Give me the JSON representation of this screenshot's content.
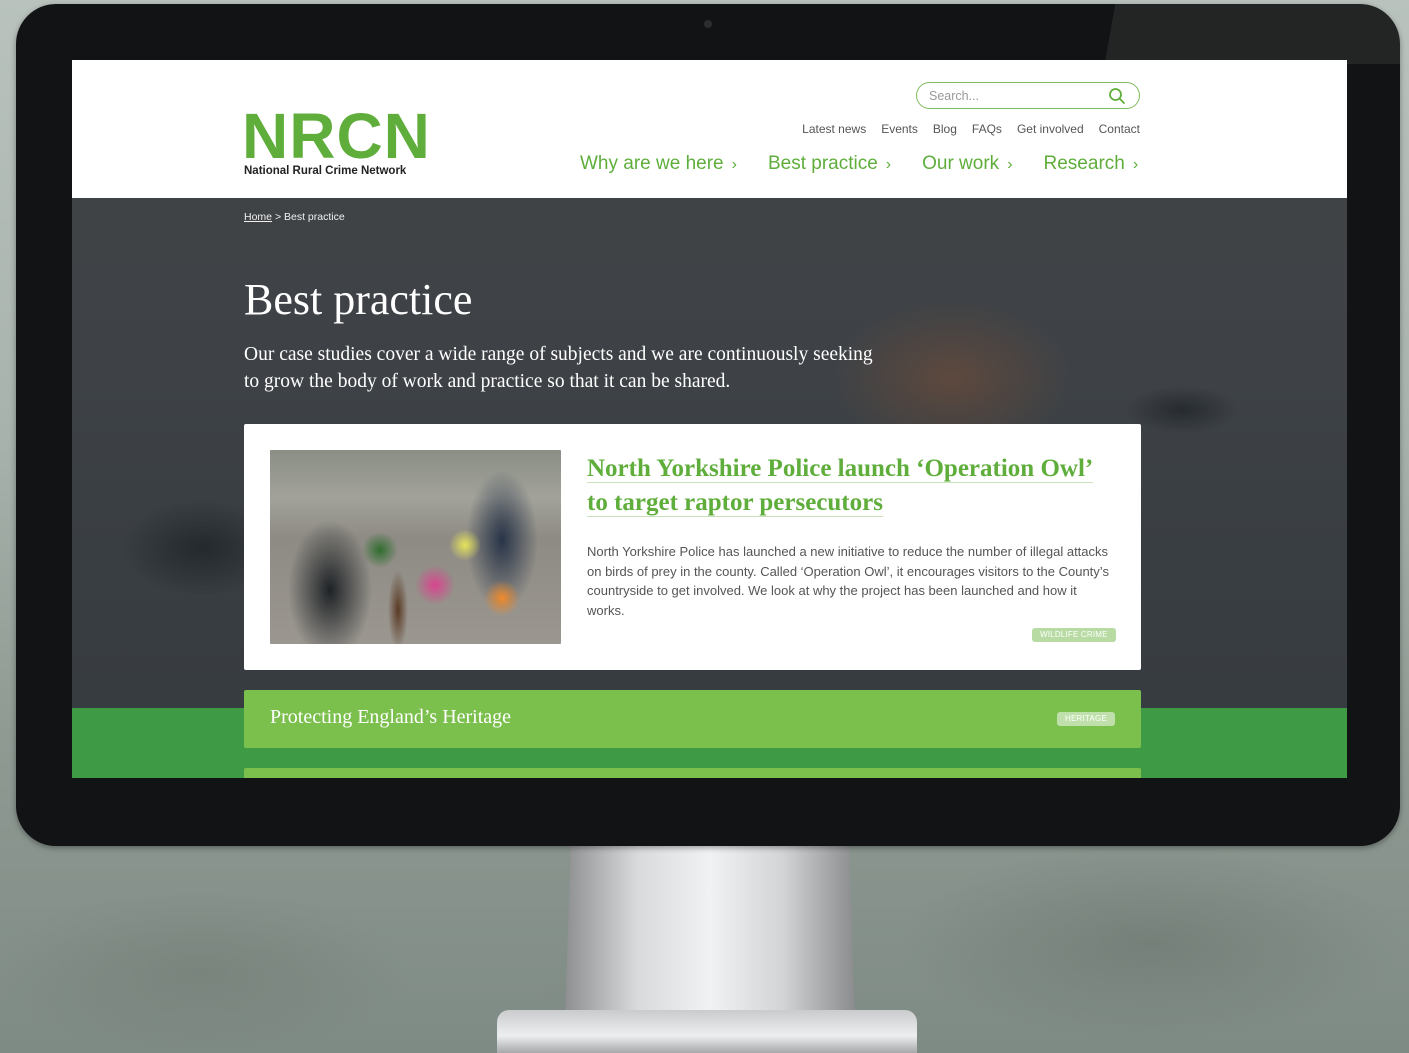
{
  "colors": {
    "brand_green": "#5fae3c",
    "card_green": "#7bbf4d",
    "band_green": "#3f9a46",
    "bezel": "#121314"
  },
  "header": {
    "logo": {
      "mark": "NRCN",
      "subtitle": "National Rural Crime Network"
    },
    "search": {
      "placeholder": "Search...",
      "icon": "search-icon"
    },
    "utility_nav": [
      "Latest news",
      "Events",
      "Blog",
      "FAQs",
      "Get involved",
      "Contact"
    ],
    "main_nav": [
      {
        "label": "Why are we here",
        "chevron": "›"
      },
      {
        "label": "Best practice",
        "chevron": "›"
      },
      {
        "label": "Our work",
        "chevron": "›"
      },
      {
        "label": "Research",
        "chevron": "›"
      }
    ]
  },
  "breadcrumb": {
    "home": "Home",
    "separator": ">",
    "current": "Best practice"
  },
  "hero": {
    "title": "Best practice",
    "description": "Our case studies cover a wide range of subjects and we are continuously seeking to grow the body of work and practice so that it can be shared."
  },
  "featured": {
    "title": "North Yorkshire Police launch ‘Operation Owl’ to target raptor persecutors",
    "body": "North Yorkshire Police has launched a new initiative to reduce the number of illegal attacks on birds of prey in the county. Called ‘Operation Owl’, it encourages visitors to the County’s countryside to get involved. We look at why the project has been launched and how it works.",
    "tag": "WILDLIFE CRIME"
  },
  "list_items": [
    {
      "title": "Protecting England’s Heritage",
      "tag": "HERITAGE"
    }
  ]
}
